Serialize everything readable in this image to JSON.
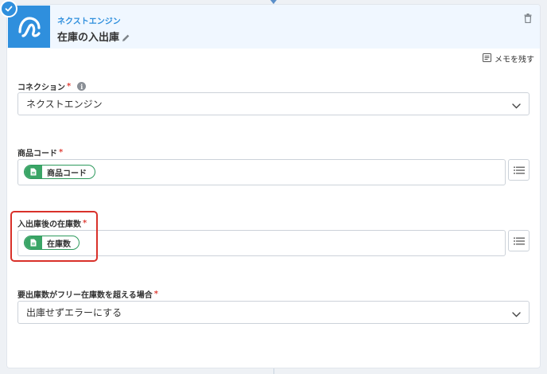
{
  "header": {
    "app_name": "ネクストエンジン",
    "action_title": "在庫の入出庫"
  },
  "memo": {
    "label": "メモを残す"
  },
  "fields": {
    "connection": {
      "label": "コネクション",
      "required_mark": "*",
      "value": "ネクストエンジン"
    },
    "product_code": {
      "label": "商品コード",
      "required_mark": "*",
      "chip": "商品コード"
    },
    "stock_after": {
      "label": "入出庫後の在庫数",
      "required_mark": "*",
      "chip": "在庫数"
    },
    "over_free_stock": {
      "label": "要出庫数がフリー在庫数を超える場合",
      "required_mark": "*",
      "value": "出庫せずエラーにする"
    }
  },
  "colors": {
    "accent": "#2f8fdd",
    "chip_green": "#3aa566",
    "required_red": "#e0433b",
    "highlight_red": "#d9312a"
  }
}
